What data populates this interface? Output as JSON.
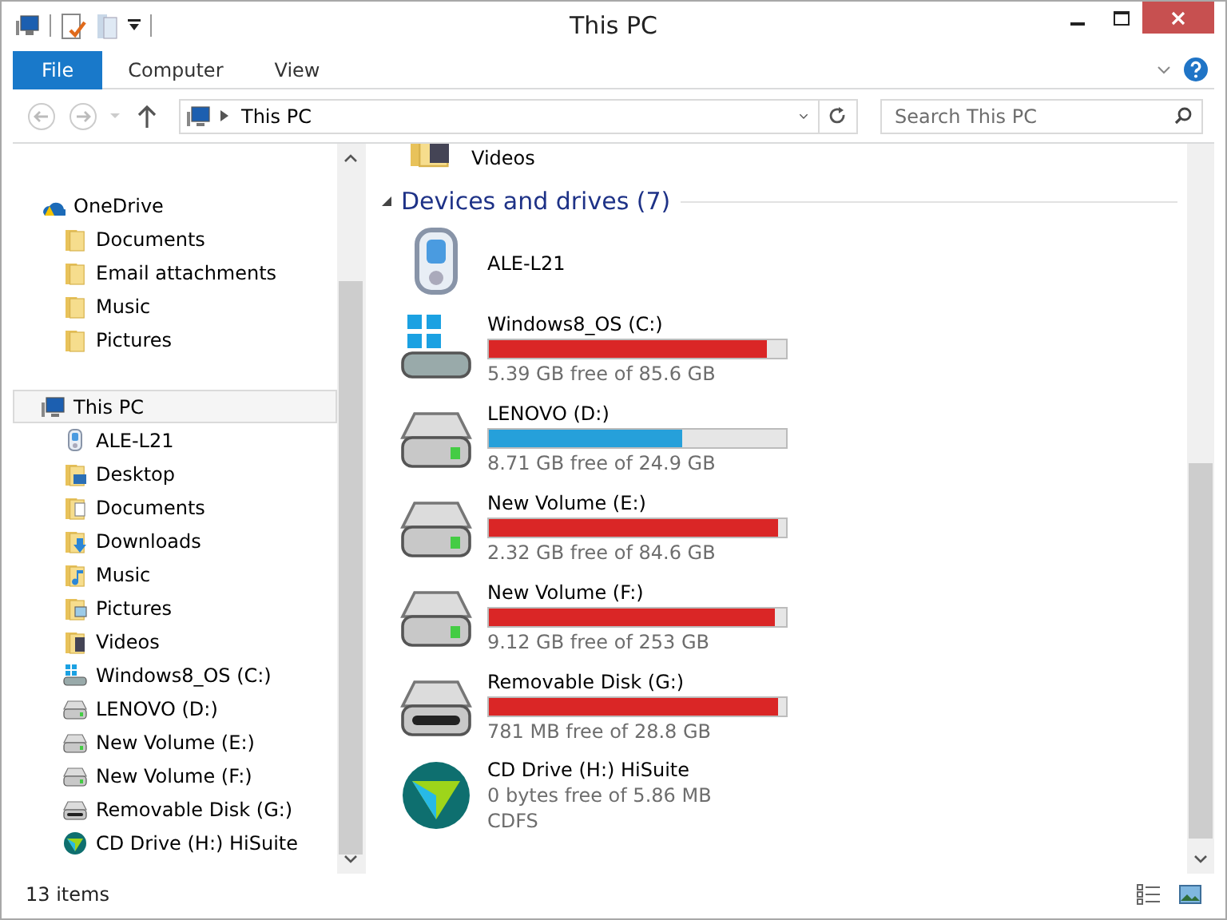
{
  "window": {
    "title": "This PC"
  },
  "ribbon": {
    "tabs": [
      {
        "label": "File",
        "selected": true
      },
      {
        "label": "Computer",
        "selected": false
      },
      {
        "label": "View",
        "selected": false
      }
    ]
  },
  "address": {
    "path": "This PC",
    "search_placeholder": "Search This PC"
  },
  "nav": [
    {
      "label": "OneDrive",
      "kind": "cloud",
      "selected": false,
      "children": [
        {
          "label": "Documents",
          "kind": "folder"
        },
        {
          "label": "Email attachments",
          "kind": "folder"
        },
        {
          "label": "Music",
          "kind": "folder"
        },
        {
          "label": "Pictures",
          "kind": "folder"
        }
      ]
    },
    {
      "label": "This PC",
      "kind": "pc",
      "selected": true,
      "children": [
        {
          "label": "ALE-L21",
          "kind": "phone"
        },
        {
          "label": "Desktop",
          "kind": "desktop"
        },
        {
          "label": "Documents",
          "kind": "documents"
        },
        {
          "label": "Downloads",
          "kind": "downloads"
        },
        {
          "label": "Music",
          "kind": "music"
        },
        {
          "label": "Pictures",
          "kind": "pictures"
        },
        {
          "label": "Videos",
          "kind": "videos"
        },
        {
          "label": "Windows8_OS (C:)",
          "kind": "windows-drive"
        },
        {
          "label": "LENOVO (D:)",
          "kind": "drive"
        },
        {
          "label": "New Volume (E:)",
          "kind": "drive"
        },
        {
          "label": "New Volume (F:)",
          "kind": "drive"
        },
        {
          "label": "Removable Disk (G:)",
          "kind": "removable"
        },
        {
          "label": "CD Drive (H:) HiSuite",
          "kind": "hisuite"
        }
      ]
    }
  ],
  "content": {
    "top_item": {
      "label": "Videos",
      "kind": "videos"
    },
    "group": {
      "title": "Devices and drives (7)",
      "expanded": true
    },
    "devices": [
      {
        "name": "ALE-L21",
        "kind": "phone"
      },
      {
        "name": "Windows8_OS (C:)",
        "kind": "windows-drive",
        "level": 0.937,
        "color": "#da2626",
        "reading": "5.39 GB free of 85.6 GB"
      },
      {
        "name": "LENOVO (D:)",
        "kind": "drive",
        "level": 0.65,
        "color": "#26a0da",
        "reading": "8.71 GB free of 24.9 GB"
      },
      {
        "name": "New Volume (E:)",
        "kind": "drive",
        "level": 0.973,
        "color": "#da2626",
        "reading": "2.32 GB free of 84.6 GB"
      },
      {
        "name": "New Volume (F:)",
        "kind": "drive",
        "level": 0.964,
        "color": "#da2626",
        "reading": "9.12 GB free of 253 GB"
      },
      {
        "name": "Removable Disk (G:)",
        "kind": "removable",
        "level": 0.973,
        "color": "#da2626",
        "reading": "781 MB free of 28.8 GB"
      },
      {
        "name": "CD Drive (H:) HiSuite",
        "kind": "hisuite",
        "reading": "0 bytes free of 5.86 MB",
        "extra": "CDFS"
      }
    ]
  },
  "status_bar": {
    "count": "13 items"
  }
}
